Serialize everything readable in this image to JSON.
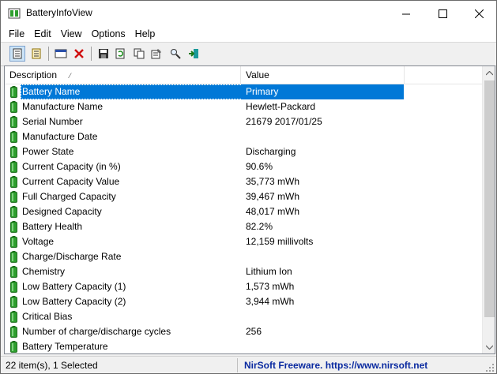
{
  "window": {
    "title": "BatteryInfoView"
  },
  "menu": [
    "File",
    "Edit",
    "View",
    "Options",
    "Help"
  ],
  "columns": {
    "description": "Description",
    "value": "Value"
  },
  "rows": [
    {
      "description": "Battery Name",
      "value": "Primary",
      "selected": true
    },
    {
      "description": "Manufacture Name",
      "value": "Hewlett-Packard"
    },
    {
      "description": "Serial Number",
      "value": "21679 2017/01/25"
    },
    {
      "description": "Manufacture Date",
      "value": ""
    },
    {
      "description": "Power State",
      "value": "Discharging"
    },
    {
      "description": "Current Capacity (in %)",
      "value": "90.6%"
    },
    {
      "description": "Current Capacity Value",
      "value": "35,773 mWh"
    },
    {
      "description": "Full Charged Capacity",
      "value": "39,467 mWh"
    },
    {
      "description": "Designed Capacity",
      "value": "48,017 mWh"
    },
    {
      "description": "Battery Health",
      "value": "82.2%"
    },
    {
      "description": "Voltage",
      "value": "12,159 millivolts"
    },
    {
      "description": "Charge/Discharge Rate",
      "value": ""
    },
    {
      "description": "Chemistry",
      "value": "Lithium Ion"
    },
    {
      "description": "Low Battery Capacity (1)",
      "value": "1,573 mWh"
    },
    {
      "description": "Low Battery Capacity (2)",
      "value": "3,944 mWh"
    },
    {
      "description": "Critical Bias",
      "value": ""
    },
    {
      "description": "Number of charge/discharge cycles",
      "value": "256"
    },
    {
      "description": "Battery Temperature",
      "value": ""
    }
  ],
  "status": {
    "items": "22 item(s), 1 Selected",
    "credit": "NirSoft Freeware. https://www.nirsoft.net"
  },
  "colors": {
    "selection": "#0078d7",
    "battery_green": "#2e9e2e",
    "credit_blue": "#0a2aa0"
  }
}
